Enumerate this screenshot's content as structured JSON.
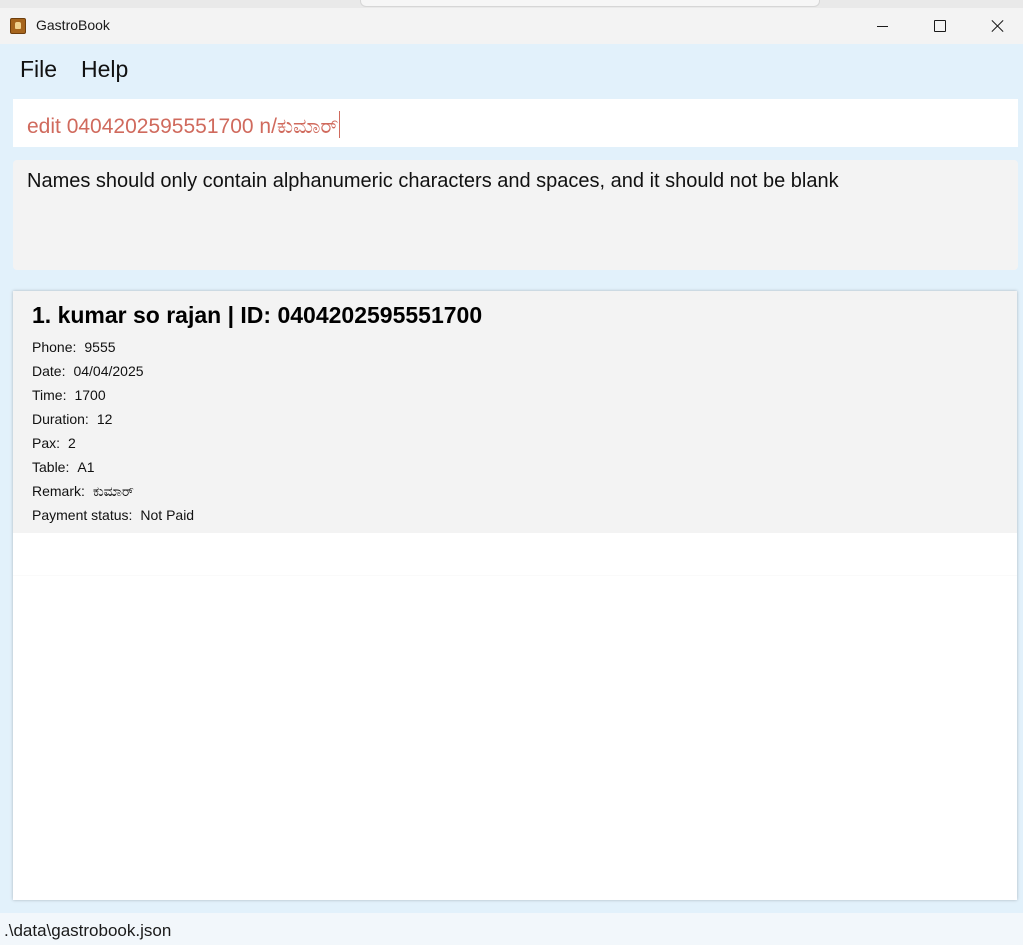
{
  "window": {
    "title": "GastroBook"
  },
  "menu": {
    "file": "File",
    "help": "Help"
  },
  "command": {
    "value": "edit 0404202595551700 n/ಕುಮಾರ್"
  },
  "result": {
    "message": "Names should only contain alphanumeric characters and spaces, and it should not be blank"
  },
  "reservations": [
    {
      "title": "1. kumar so rajan | ID: 0404202595551700",
      "fields": [
        {
          "label": "Phone:",
          "value": "9555"
        },
        {
          "label": "Date:",
          "value": "04/04/2025"
        },
        {
          "label": "Time:",
          "value": "1700"
        },
        {
          "label": "Duration:",
          "value": "12"
        },
        {
          "label": "Pax:",
          "value": "2"
        },
        {
          "label": "Table:",
          "value": "A1"
        },
        {
          "label": "Remark:",
          "value": "ಕುಮಾರ್"
        },
        {
          "label": "Payment status:",
          "value": "Not Paid"
        }
      ]
    }
  ],
  "status": {
    "path": ".\\data\\gastrobook.json"
  },
  "colors": {
    "window_background": "#e2f1fb",
    "command_text": "#d06a5d",
    "card_background": "#f3f3f3"
  },
  "icons": {
    "app": "address-book-icon",
    "minimize": "minimize-icon",
    "maximize": "maximize-icon",
    "close": "close-icon"
  }
}
